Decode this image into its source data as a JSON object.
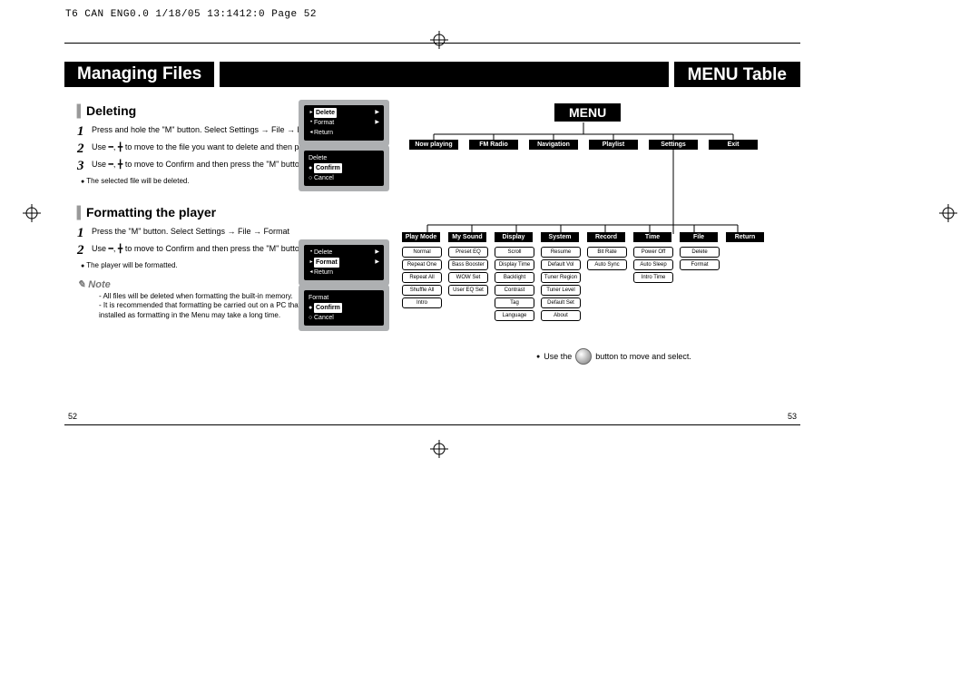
{
  "header_info": "T6 CAN ENG0.0  1/18/05 13:1412:0  Page 52",
  "title_left": "Managing Files",
  "title_right": "MENU Table",
  "page_left_num": "52",
  "page_right_num": "53",
  "left": {
    "deleting": {
      "heading": "Deleting",
      "step1": "Press and hole the \"M\" button. Select Settings → File → Delete.",
      "step2": "Use ━, ╋ to move to the file you want to delete and then press the \"M\" button.",
      "step3": "Use ━, ╋ to move to Confirm and then press the \"M\" button.",
      "bullet": "The selected file will be deleted."
    },
    "formatting": {
      "heading": "Formatting the player",
      "step1": "Press the \"M\" button. Select Settings → File → Format",
      "step2": "Use ━, ╋ to move to Confirm and then press the \"M\" button.",
      "bullet": "The player will be formatted.",
      "note_head": "Note",
      "note1": "All files will be deleted when formatting the built-in memory.",
      "note2": "It is recommended that formatting be carried out on a PC that has the provided program installed as formatting in the Menu may take a long time."
    },
    "screens": {
      "s1": {
        "a": "Delete",
        "b": "Format",
        "c": "Return"
      },
      "s2": {
        "t": "Delete",
        "a": "Confirm",
        "b": "Cancel"
      },
      "s3": {
        "a": "Delete",
        "b": "Format",
        "c": "Return"
      },
      "s4": {
        "t": "Format",
        "a": "Confirm",
        "b": "Cancel"
      }
    }
  },
  "right": {
    "menu_root": "MENU",
    "row1": [
      "Now playing",
      "FM Radio",
      "Navigation",
      "Playlist",
      "Settings",
      "Exit"
    ],
    "row2_heads": [
      "Play Mode",
      "My Sound",
      "Display",
      "System",
      "Record",
      "Time",
      "File",
      "Return"
    ],
    "row2_cols": [
      [
        "Normal",
        "Repeat One",
        "Repeat All",
        "Shuffle All",
        "Intro"
      ],
      [
        "Preset EQ",
        "Bass Booster",
        "WOW Set",
        "User EQ Set"
      ],
      [
        "Scroll",
        "Display Time",
        "Backlight",
        "Contrast",
        "Tag",
        "Language"
      ],
      [
        "Resume",
        "Default Vol",
        "Tuner Region",
        "Tuner Level",
        "Default Set",
        "About"
      ],
      [
        "Bit Rate",
        "Auto Sync"
      ],
      [
        "Power Off",
        "Auto Sleep",
        "Intro Time"
      ],
      [
        "Delete",
        "Format"
      ],
      []
    ],
    "hint_a": "Use the",
    "hint_b": "button to move and select."
  }
}
